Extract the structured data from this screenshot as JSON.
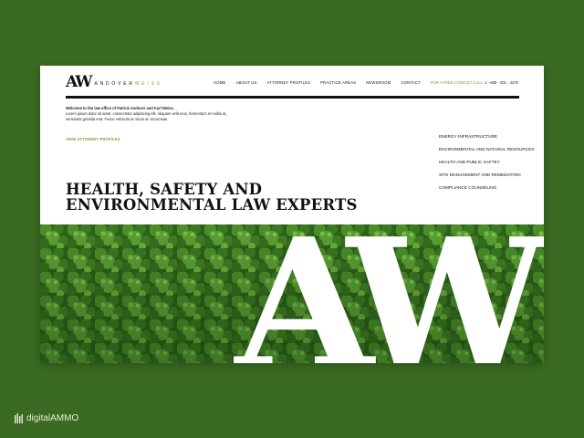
{
  "brand": {
    "mark": "AW",
    "word1": "ANDOVER",
    "word2": "WEISS"
  },
  "nav": {
    "items": [
      "HOME",
      "ABOUT US",
      "ATTORNEY PROFILES",
      "PRACTICE AREAS",
      "NEWSROOM",
      "CONTACT"
    ],
    "cta_label": "FOR A FREE CONSULT CALL:",
    "cta_phone": "1 - 800 - 201 - 4470"
  },
  "intro": {
    "lead": "Welcome to the law office of Patrick Andover and Karl Weiss.",
    "body": "Lorem ipsum dolor sit amet, consectetur adipiscing elit. Aliquam velit eros, fermentum et mollis at, venenatis gravida erat. Fusce vehicula ac lacus ac accumsan."
  },
  "view_link": "VIEW ATTORNEY PROFILES",
  "practice_areas": [
    "ENERGY INFRASTRUCTURE",
    "ENVIRONMENTAL AND NATURAL RESOURCES",
    "HEALTH AND PUBLIC SAFTEY",
    "SITE MANAGEMENT AND REMEDIATION",
    "COMPLIANCE COUNSELING"
  ],
  "headline": {
    "line1": "HEALTH, SAFETY AND",
    "line2": "ENVIRONMENTAL LAW EXPERTS"
  },
  "hero_mark": "AW",
  "watermark": "digitalAMMO",
  "colors": {
    "background": "#3b6b22",
    "accent": "#7d9a2d",
    "forest": "#2f6b1c"
  }
}
